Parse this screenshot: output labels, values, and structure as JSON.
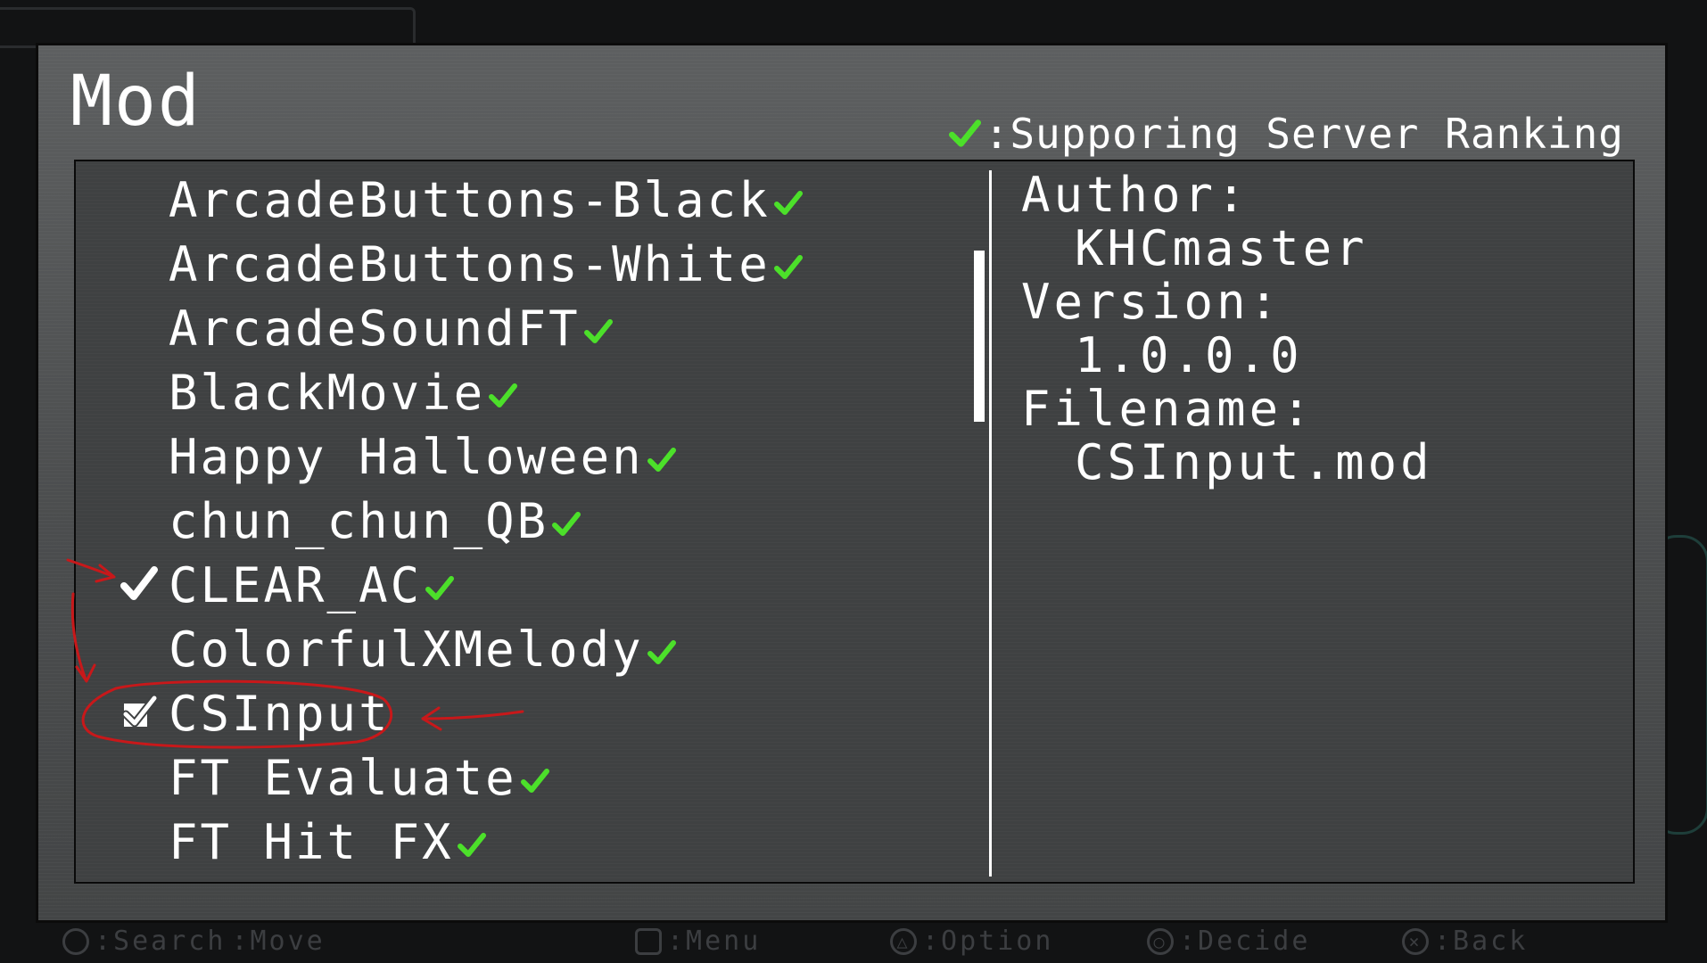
{
  "dialog": {
    "title": "Mod",
    "legend_label": ":Supporing Server Ranking",
    "legend_icon": "green-check-icon"
  },
  "mods": [
    {
      "name": "ArcadeButtons-Black",
      "ranking": true,
      "selected": false
    },
    {
      "name": "ArcadeButtons-White",
      "ranking": true,
      "selected": false
    },
    {
      "name": "ArcadeSoundFT",
      "ranking": true,
      "selected": false
    },
    {
      "name": "BlackMovie",
      "ranking": true,
      "selected": false
    },
    {
      "name": "Happy Halloween",
      "ranking": true,
      "selected": false
    },
    {
      "name": "chun_chun_QB",
      "ranking": true,
      "selected": false
    },
    {
      "name": "CLEAR_AC",
      "ranking": true,
      "selected": true
    },
    {
      "name": "ColorfulXMelody",
      "ranking": true,
      "selected": false
    },
    {
      "name": "CSInput",
      "ranking": false,
      "selected": true,
      "cursor": true
    },
    {
      "name": "FT Evaluate",
      "ranking": true,
      "selected": false
    },
    {
      "name": "FT Hit FX",
      "ranking": true,
      "selected": false
    }
  ],
  "details": {
    "author_label": "Author:",
    "author": "KHCmaster",
    "version_label": "Version:",
    "version": "1.0.0.0",
    "filename_label": "Filename:",
    "filename": "CSInput.mod"
  },
  "footer": {
    "hints": [
      {
        "icon": "stick-icon",
        "label": ":Search",
        "extra": ":Move"
      },
      {
        "icon": "square-button-icon",
        "label": ":Menu"
      },
      {
        "icon": "triangle-button-icon",
        "label": ":Option"
      },
      {
        "icon": "circle-button-icon",
        "label": ":Decide"
      },
      {
        "icon": "cross-button-icon",
        "label": ":Back"
      }
    ]
  },
  "colors": {
    "ranking_check": "#4ce02a",
    "annotation": "#c8181a",
    "text": "#ffffff"
  }
}
